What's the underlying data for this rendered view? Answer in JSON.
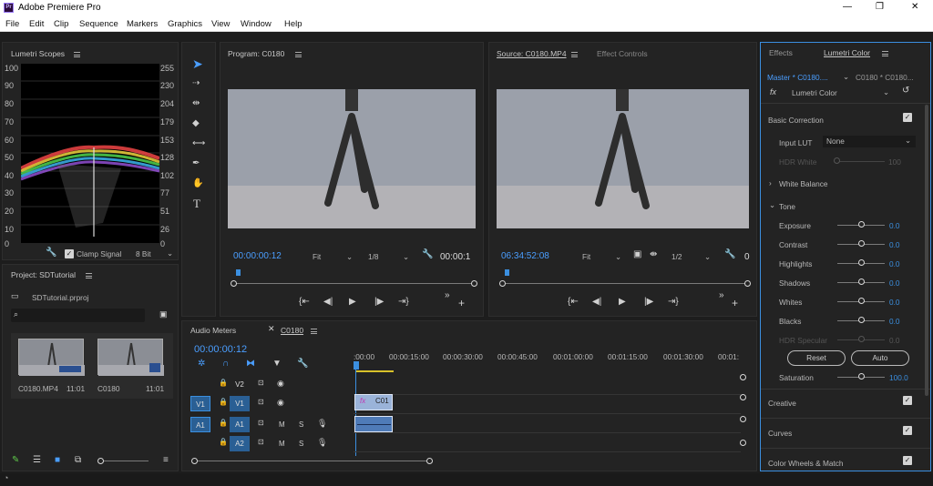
{
  "app": {
    "title": "Adobe Premiere Pro",
    "logo": "Pr"
  },
  "window_controls": {
    "minimize": "—",
    "maximize": "❐",
    "close": "✕"
  },
  "menu": [
    "File",
    "Edit",
    "Clip",
    "Sequence",
    "Markers",
    "Graphics",
    "View",
    "Window",
    "Help"
  ],
  "scopes": {
    "title": "Lumetri Scopes",
    "left_scale": [
      "100",
      "90",
      "80",
      "70",
      "60",
      "50",
      "40",
      "30",
      "20",
      "10",
      "0"
    ],
    "right_scale": [
      "255",
      "230",
      "204",
      "179",
      "153",
      "128",
      "102",
      "77",
      "51",
      "26",
      "0"
    ],
    "clamp_label": "Clamp Signal",
    "clamp_checked": true,
    "bit_depth": "8 Bit"
  },
  "project": {
    "title": "Project: SDTutorial",
    "file": "SDTutorial.prproj",
    "search_placeholder": "",
    "items": [
      {
        "name": "C0180.MP4",
        "duration": "11:01"
      },
      {
        "name": "C0180",
        "duration": "11:01"
      }
    ]
  },
  "program": {
    "title": "Program: C0180",
    "timecode": "00:00:00:12",
    "fit": "Fit",
    "resolution": "1/8",
    "end_timecode": "00:00:1"
  },
  "source": {
    "title": "Source: C0180.MP4",
    "tab2": "Effect Controls",
    "timecode": "06:34:52:08",
    "fit": "Fit",
    "resolution": "1/2",
    "end_timecode": "0"
  },
  "timeline": {
    "tab_audio": "Audio Meters",
    "tab_seq": "C0180",
    "timecode": "00:00:00:12",
    "ruler": [
      ":00:00",
      "00:00:15:00",
      "00:00:30:00",
      "00:00:45:00",
      "00:01:00:00",
      "00:01:15:00",
      "00:01:30:00",
      "00:01:"
    ],
    "tracks": [
      {
        "target": "",
        "name": "V2",
        "kind": "video"
      },
      {
        "target": "V1",
        "name": "V1",
        "kind": "video"
      },
      {
        "target": "A1",
        "name": "A1",
        "kind": "audio",
        "m": "M",
        "s": "S"
      },
      {
        "target": "",
        "name": "A2",
        "kind": "audio",
        "m": "M",
        "s": "S"
      }
    ],
    "clip_label": "C01",
    "fx": "fx"
  },
  "lumetri": {
    "tab_effects": "Effects",
    "tab_lumetri": "Lumetri Color",
    "master": "Master * C0180....",
    "clip": "C0180 * C0180...",
    "fx": "fx",
    "effect": "Lumetri Color",
    "basic": "Basic Correction",
    "input_lut_label": "Input LUT",
    "input_lut_value": "None",
    "hdr_white_label": "HDR White",
    "hdr_white_value": "100",
    "white_balance": "White Balance",
    "tone": "Tone",
    "controls": [
      {
        "label": "Exposure",
        "value": "0.0"
      },
      {
        "label": "Contrast",
        "value": "0.0"
      },
      {
        "label": "Highlights",
        "value": "0.0"
      },
      {
        "label": "Shadows",
        "value": "0.0"
      },
      {
        "label": "Whites",
        "value": "0.0"
      },
      {
        "label": "Blacks",
        "value": "0.0"
      },
      {
        "label": "HDR Specular",
        "value": "0.0"
      }
    ],
    "reset": "Reset",
    "auto": "Auto",
    "saturation_label": "Saturation",
    "saturation_value": "100.0",
    "sections": [
      "Creative",
      "Curves",
      "Color Wheels & Match"
    ]
  }
}
